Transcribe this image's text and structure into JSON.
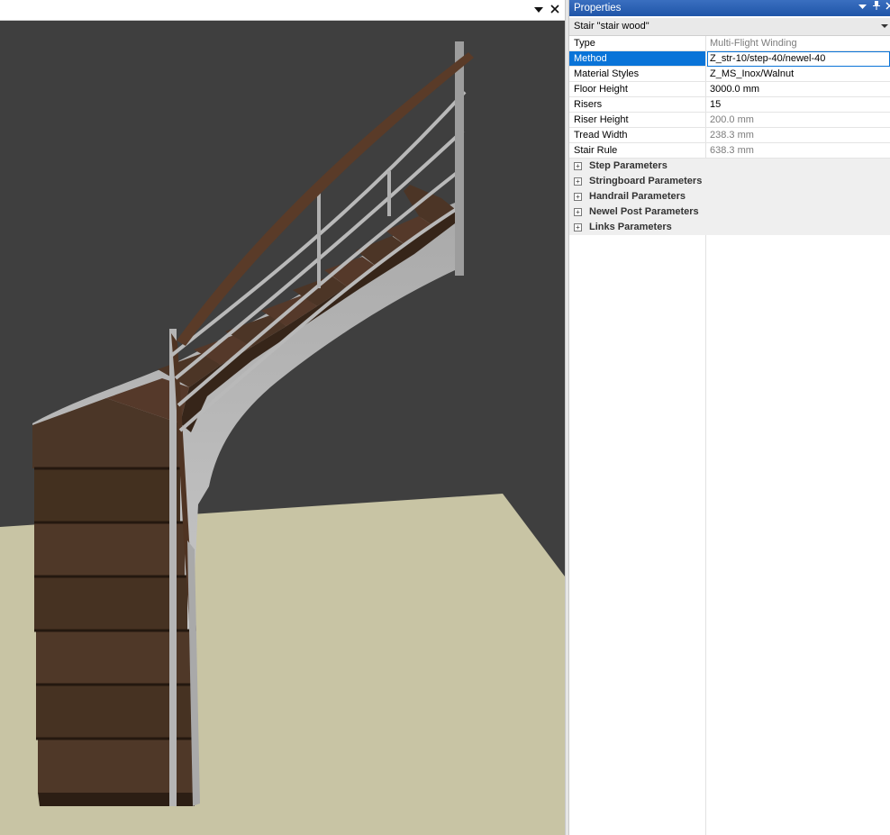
{
  "viewport": {
    "menu_icon": "chevron-down-icon",
    "close_icon": "close-icon",
    "colors": {
      "background": "#3f3f3f",
      "floor": "#c8c4a4",
      "wood": "#4a3426",
      "metal": "#b9b9b9"
    }
  },
  "properties": {
    "title": "Properties",
    "title_icons": [
      "chevron-down-icon",
      "pin-icon",
      "close-icon"
    ],
    "object_selector": "Stair \"stair wood\"",
    "rows": [
      {
        "name": "Type",
        "value": "Multi-Flight Winding"
      },
      {
        "name": "Method",
        "value": "Z_str-10/step-40/newel-40"
      },
      {
        "name": "Material Styles",
        "value": "Z_MS_Inox/Walnut"
      },
      {
        "name": "Floor Height",
        "value": "3000.0 mm"
      },
      {
        "name": "Risers",
        "value": "15"
      },
      {
        "name": "Riser Height",
        "value": "200.0 mm"
      },
      {
        "name": "Tread Width",
        "value": "238.3 mm"
      },
      {
        "name": "Stair Rule",
        "value": "638.3 mm"
      }
    ],
    "groups": [
      {
        "label": "Step Parameters"
      },
      {
        "label": "Stringboard Parameters"
      },
      {
        "label": "Handrail Parameters"
      },
      {
        "label": "Newel Post Parameters"
      },
      {
        "label": "Links Parameters"
      }
    ],
    "colors": {
      "title_bar": "#1f55a8",
      "selection": "#0a74d8"
    }
  }
}
